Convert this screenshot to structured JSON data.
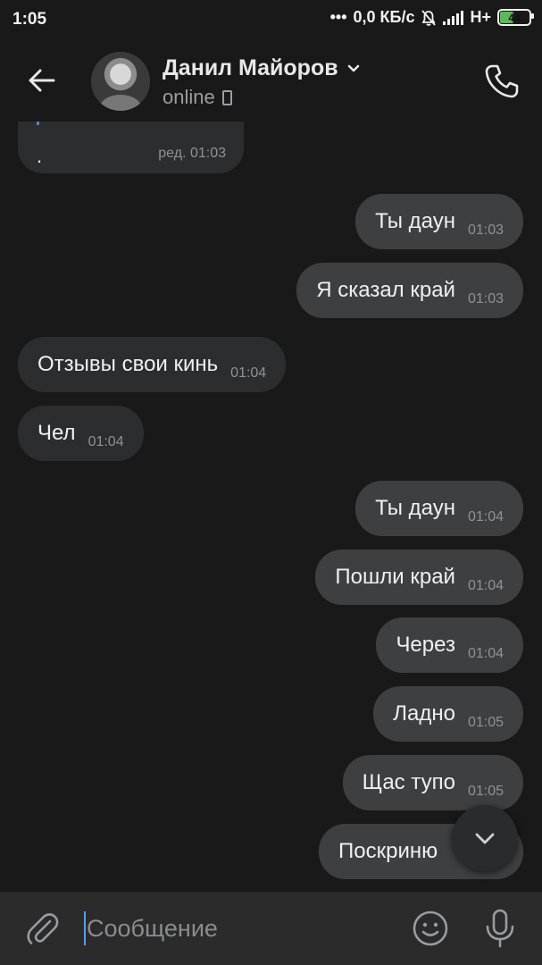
{
  "status_bar": {
    "time": "1:05",
    "network_speed": "0,0 КБ/с",
    "network_type": "H+",
    "battery": "44"
  },
  "header": {
    "contact_name": "Данил Майоров",
    "status": "online",
    "icons": [
      "back-arrow-icon",
      "chevron-down-icon",
      "mobile-icon",
      "phone-icon"
    ]
  },
  "messages": [
    {
      "text": ".",
      "time": "ред. 01:03",
      "direction": "in"
    },
    {
      "text": "Ты даун",
      "time": "01:03",
      "direction": "out"
    },
    {
      "text": "Я сказал край",
      "time": "01:03",
      "direction": "out"
    },
    {
      "text": "Отзывы свои кинь",
      "time": "01:04",
      "direction": "in"
    },
    {
      "text": "Чел",
      "time": "01:04",
      "direction": "in"
    },
    {
      "text": "Ты даун",
      "time": "01:04",
      "direction": "out"
    },
    {
      "text": "Пошли край",
      "time": "01:04",
      "direction": "out"
    },
    {
      "text": "Через",
      "time": "01:04",
      "direction": "out"
    },
    {
      "text": "Ладно",
      "time": "01:05",
      "direction": "out"
    },
    {
      "text": "Щас тупо",
      "time": "01:05",
      "direction": "out"
    },
    {
      "text": "Поскриню",
      "time": "",
      "direction": "out"
    }
  ],
  "composer": {
    "placeholder": "Сообщение",
    "icons": [
      "paperclip-icon",
      "emoji-icon",
      "microphone-icon"
    ]
  },
  "colors": {
    "background": "#19191a",
    "incoming_bubble": "#2c2d2e",
    "outgoing_bubble": "#3e3f41",
    "accent": "#5a9cf5",
    "battery": "#5cb85c"
  }
}
